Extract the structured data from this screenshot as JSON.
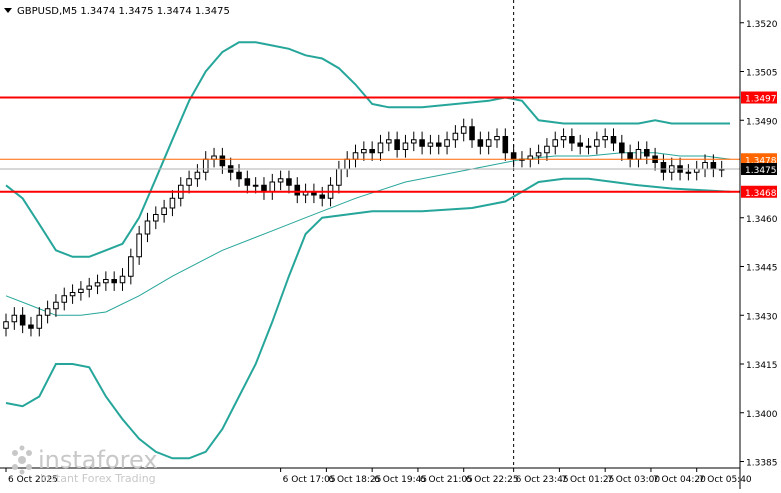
{
  "header": {
    "symbol_line": "GBPUSD,M5  1.3474 1.3475 1.3474 1.3475",
    "menu_icon": "triangle-down-icon"
  },
  "watermark": {
    "brand": "instaforex",
    "tagline": "Instant Forex Trading"
  },
  "colors": {
    "background": "#ffffff",
    "candle": "#000000",
    "band": "#26a69a",
    "ma": "#26a69a",
    "resistance_line": "#ff0000",
    "pivot_line": "#ff6600",
    "current_price_label": "#000000",
    "vertical_marker": "#000000"
  },
  "chart_data": {
    "type": "candlestick",
    "symbol": "GBPUSD",
    "timeframe": "M5",
    "ohlc_header": {
      "open": 1.3474,
      "high": 1.3475,
      "low": 1.3474,
      "close": 1.3475
    },
    "ylim": [
      1.3383,
      1.3527
    ],
    "y_ticks": [
      "1.3520",
      "1.3505",
      "1.3490",
      "1.3460",
      "1.3445",
      "1.3430",
      "1.3415",
      "1.3400",
      "1.3385"
    ],
    "x_ticks": [
      "6 Oct 2025",
      "6 Oct 17:05",
      "6 Oct 18:25",
      "6 Oct 19:45",
      "6 Oct 21:05",
      "6 Oct 22:25",
      "6 Oct 23:45",
      "7 Oct 01:25",
      "7 Oct 03:00",
      "7 Oct 04:20",
      "7 Oct 05:40"
    ],
    "x_tick_positions": [
      0,
      33,
      38.5,
      44,
      49.5,
      55,
      61,
      66.5,
      72,
      77.5,
      83
    ],
    "x_range": [
      0,
      87
    ],
    "vertical_marker_index": 61,
    "horizontal_levels": [
      {
        "price": 1.3497,
        "label": "1.3497",
        "style": "resistance"
      },
      {
        "price": 1.3478,
        "label": "1.3478",
        "style": "pivot"
      },
      {
        "price": 1.3468,
        "label": "1.3468",
        "style": "resistance"
      }
    ],
    "current_price": {
      "price": 1.3475,
      "label": "1.3475"
    },
    "closes": [
      1.3428,
      1.343,
      1.3427,
      1.3426,
      1.343,
      1.3432,
      1.3434,
      1.3436,
      1.3437,
      1.3438,
      1.3439,
      1.344,
      1.3441,
      1.344,
      1.3442,
      1.3448,
      1.3455,
      1.3459,
      1.3461,
      1.3463,
      1.3466,
      1.347,
      1.3472,
      1.3474,
      1.3478,
      1.3479,
      1.3476,
      1.3474,
      1.3472,
      1.347,
      1.347,
      1.3468,
      1.3471,
      1.3472,
      1.347,
      1.3467,
      1.3468,
      1.3467,
      1.3466,
      1.347,
      1.3475,
      1.3478,
      1.348,
      1.3481,
      1.348,
      1.3483,
      1.3484,
      1.3481,
      1.3483,
      1.3484,
      1.3482,
      1.3483,
      1.3482,
      1.3484,
      1.3486,
      1.3488,
      1.3484,
      1.3482,
      1.3484,
      1.3485,
      1.348,
      1.3478,
      1.3478,
      1.3479,
      1.348,
      1.3482,
      1.3484,
      1.3485,
      1.3483,
      1.3482,
      1.3482,
      1.3484,
      1.3485,
      1.3483,
      1.348,
      1.3478,
      1.3481,
      1.3479,
      1.3477,
      1.3474,
      1.3476,
      1.3474,
      1.3474,
      1.3475,
      1.3477,
      1.3475,
      1.3475
    ],
    "band_upper": [
      1.347,
      1.3466,
      1.3458,
      1.345,
      1.3448,
      1.3448,
      1.345,
      1.3452,
      1.346,
      1.3472,
      1.3484,
      1.3496,
      1.3505,
      1.3511,
      1.3514,
      1.3514,
      1.3513,
      1.3512,
      1.351,
      1.3509,
      1.3506,
      1.3501,
      1.3495,
      1.3494,
      1.3494,
      1.3495,
      1.3496,
      1.3497,
      1.3496,
      1.349,
      1.3489,
      1.3489,
      1.3489,
      1.3489,
      1.349,
      1.3489,
      1.3489,
      1.3489
    ],
    "band_upper_x": [
      0,
      2,
      4,
      6,
      8,
      10,
      12,
      14,
      16,
      18,
      20,
      22,
      24,
      26,
      28,
      30,
      32,
      34,
      36,
      38,
      40,
      42,
      44,
      46,
      50,
      54,
      58,
      60,
      62,
      64,
      67,
      70,
      73,
      76,
      78,
      80,
      84,
      87
    ],
    "band_lower": [
      1.3403,
      1.3402,
      1.3405,
      1.3415,
      1.3415,
      1.3414,
      1.3405,
      1.3398,
      1.3392,
      1.3388,
      1.3386,
      1.3386,
      1.3388,
      1.3395,
      1.3405,
      1.3415,
      1.3428,
      1.3442,
      1.3455,
      1.346,
      1.3462,
      1.3462,
      1.3463,
      1.3465,
      1.3468,
      1.3471,
      1.3472,
      1.3472,
      1.3471,
      1.347,
      1.3469,
      1.3468
    ],
    "band_lower_x": [
      0,
      2,
      4,
      6,
      8,
      10,
      12,
      14,
      16,
      18,
      20,
      22,
      24,
      26,
      28,
      30,
      32,
      34,
      36,
      38,
      44,
      50,
      56,
      60,
      62,
      64,
      67,
      70,
      73,
      76,
      80,
      87
    ],
    "ma": [
      1.3436,
      1.3433,
      1.343,
      1.343,
      1.3431,
      1.3436,
      1.3442,
      1.345,
      1.3456,
      1.346,
      1.3466,
      1.3471,
      1.3474,
      1.3476,
      1.3478,
      1.3479,
      1.3479,
      1.348,
      1.348,
      1.3479,
      1.3479,
      1.3478
    ],
    "ma_x": [
      0,
      3,
      6,
      9,
      12,
      16,
      20,
      26,
      32,
      36,
      42,
      48,
      54,
      58,
      62,
      66,
      70,
      74,
      78,
      81,
      84,
      87
    ]
  }
}
